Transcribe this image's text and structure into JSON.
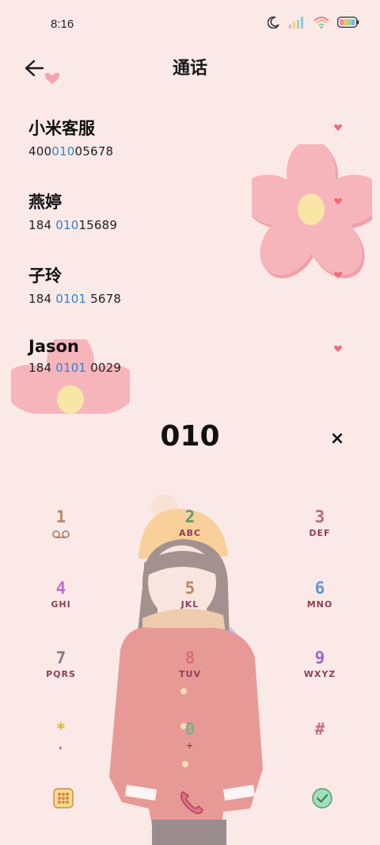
{
  "status_bar": {
    "time": "8:16"
  },
  "header": {
    "title": "通话"
  },
  "contacts": [
    {
      "name": "小米客服",
      "number_pre": "400",
      "number_hl": "010",
      "number_post": "05678"
    },
    {
      "name": "燕婷",
      "number_pre": "184 ",
      "number_hl": "010",
      "number_post": "15689"
    },
    {
      "name": "子玲",
      "number_pre": "184 ",
      "number_hl": "0101",
      "number_post": " 5678"
    },
    {
      "name": "Jason",
      "number_pre": "184 ",
      "number_hl": "0101",
      "number_post": " 0029"
    }
  ],
  "dialer": {
    "display": "010",
    "clear": "×"
  },
  "keypad": [
    {
      "digit": "1",
      "letters": ""
    },
    {
      "digit": "2",
      "letters": "ABC"
    },
    {
      "digit": "3",
      "letters": "DEF"
    },
    {
      "digit": "4",
      "letters": "GHI"
    },
    {
      "digit": "5",
      "letters": "JKL"
    },
    {
      "digit": "6",
      "letters": "MNO"
    },
    {
      "digit": "7",
      "letters": "PQRS"
    },
    {
      "digit": "8",
      "letters": "TUV"
    },
    {
      "digit": "9",
      "letters": "WXYZ"
    },
    {
      "digit": "*",
      "letters": ","
    },
    {
      "digit": "0",
      "letters": "+"
    },
    {
      "digit": "#",
      "letters": ""
    }
  ],
  "colors": {
    "background": "#fbe9e8",
    "highlight": "#2f82d6",
    "flower": "#f6b5bb",
    "flower_center": "#f9e6a6",
    "heart": "#ef6b7a",
    "call_button": "#e46f89",
    "confirm_button": "#7fd0a3"
  },
  "icons": {
    "back": "back-arrow-icon",
    "voicemail": "voicemail-icon",
    "keypad_toggle": "keypad-grid-icon",
    "call": "phone-call-icon",
    "confirm": "check-circle-icon"
  }
}
